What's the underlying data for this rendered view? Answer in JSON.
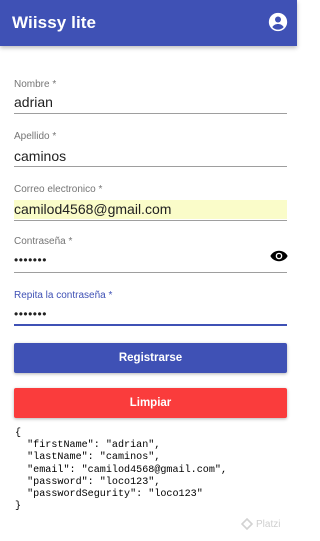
{
  "appbar": {
    "title": "Wiissy lite",
    "account_icon": "account-circle-icon"
  },
  "form": {
    "nombre": {
      "label": "Nombre *",
      "value": "adrian"
    },
    "apellido": {
      "label": "Apellido *",
      "value": "caminos"
    },
    "correo": {
      "label": "Correo electronico *",
      "value": "camilod4568@gmail.com"
    },
    "contrasena": {
      "label": "Contraseña *",
      "value": "•••••••",
      "toggle_icon": "eye-icon"
    },
    "repita": {
      "label": "Repita la contraseña *",
      "value": "•••••••"
    }
  },
  "buttons": {
    "registrarse": "Registrarse",
    "limpiar": "Limpiar"
  },
  "json_output": {
    "open": "{",
    "lines": [
      "  \"firstName\": \"adrian\",",
      "  \"lastName\": \"caminos\",",
      "  \"email\": \"camilod4568@gmail.com\",",
      "  \"password\": \"loco123\",",
      "  \"passwordSegurity\": \"loco123\""
    ],
    "close": "}"
  },
  "watermark": {
    "text": "Platzi"
  },
  "colors": {
    "primary": "#3f51b5",
    "danger": "#fa3c3c",
    "autofill": "#fafcc9"
  }
}
